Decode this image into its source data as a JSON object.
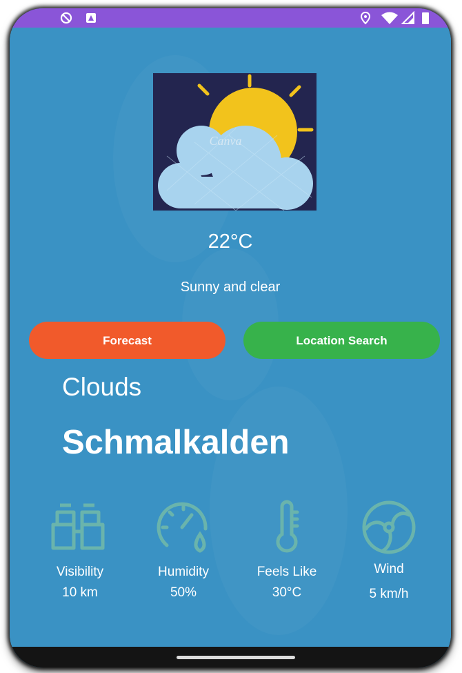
{
  "status_bar": {
    "left_icons": [
      "shield-icon",
      "notification-icon"
    ],
    "right_icons": [
      "location-icon",
      "wifi-icon",
      "signal-icon",
      "battery-icon"
    ],
    "color": "#8a55d8"
  },
  "weather_image": {
    "watermark": "Canva",
    "icon": "sun-behind-cloud-icon"
  },
  "current": {
    "temperature": "22°C",
    "description": "Sunny and clear",
    "condition": "Clouds",
    "city": "Schmalkalden"
  },
  "buttons": {
    "forecast": "Forecast",
    "location_search": "Location Search"
  },
  "stats": [
    {
      "label": "Visibility",
      "value": "10 km",
      "icon": "binoculars-icon"
    },
    {
      "label": "Humidity",
      "value": "50%",
      "icon": "humidity-gauge-icon"
    },
    {
      "label": "Feels Like",
      "value": "30°C",
      "icon": "thermometer-icon"
    },
    {
      "label": "Wind",
      "value": "5 km/h",
      "icon": "wind-fan-icon"
    }
  ],
  "colors": {
    "background": "#3a92c4",
    "forecast_button": "#f15a2b",
    "location_button": "#37b24b",
    "stat_icon": "#6ab4ac"
  }
}
